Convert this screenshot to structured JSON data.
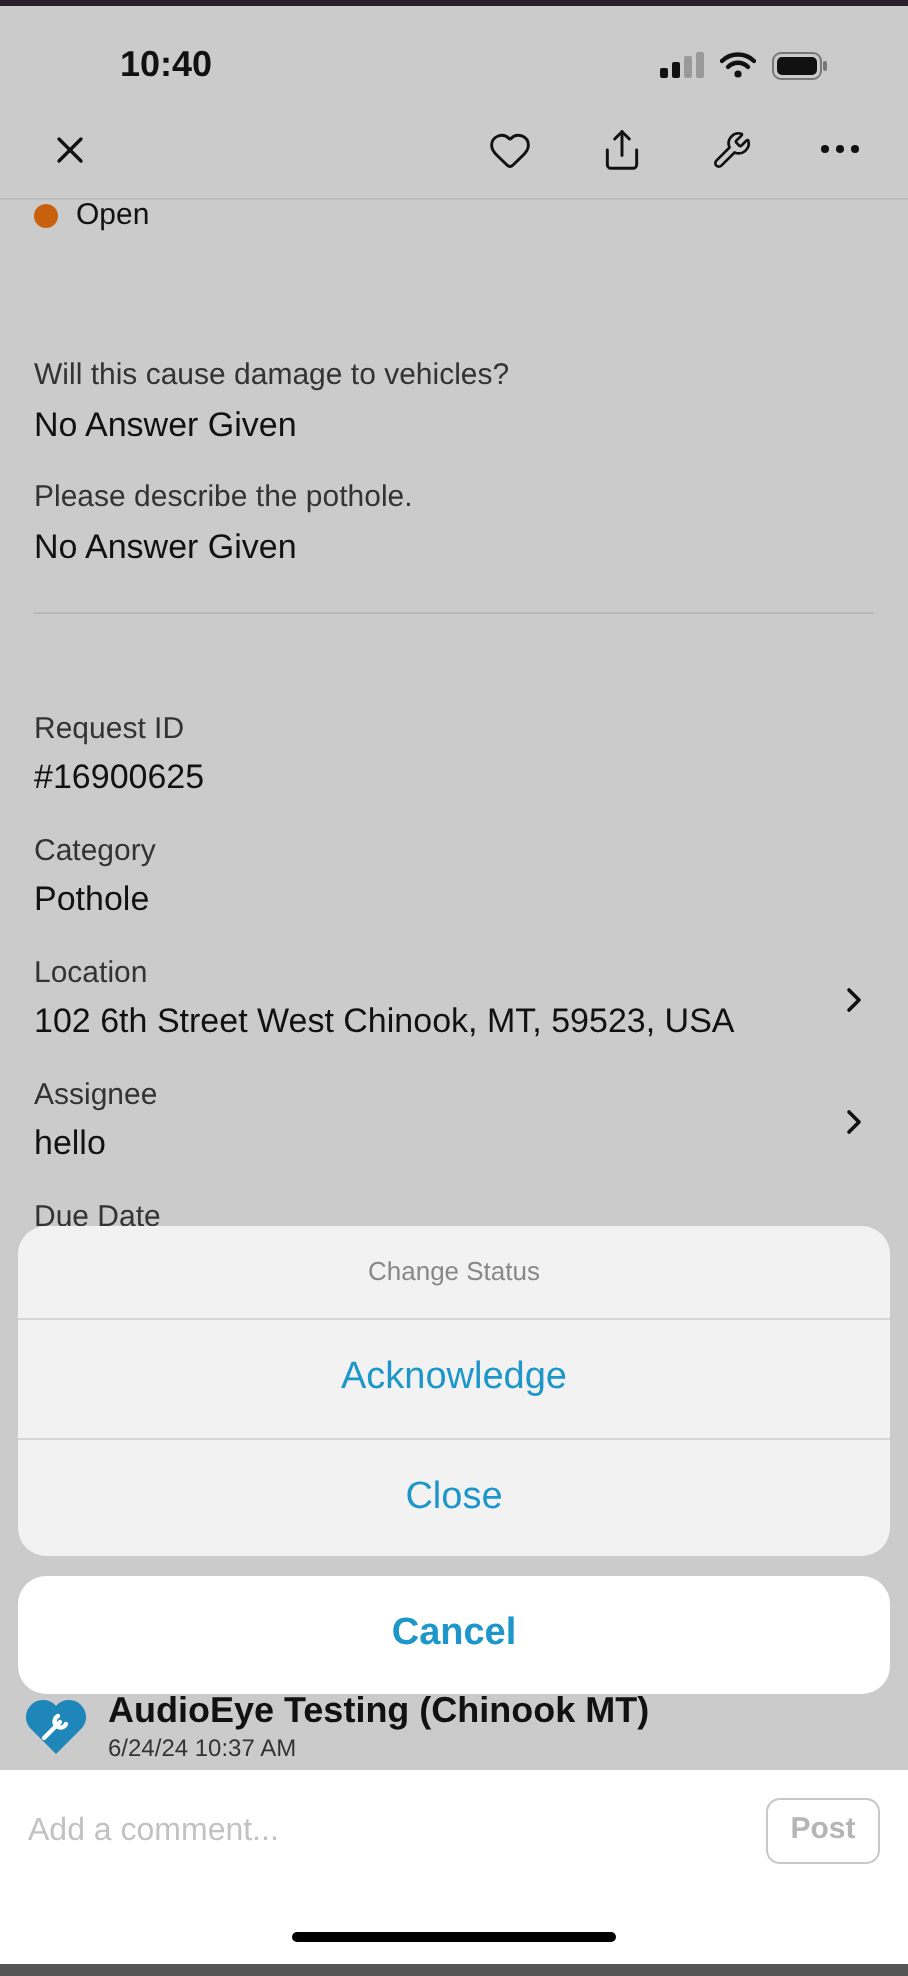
{
  "status_bar": {
    "time": "10:40"
  },
  "status": {
    "label": "Open",
    "color": "#c8600e"
  },
  "questions": [
    {
      "label": "Will this cause damage to vehicles?",
      "answer": "No Answer Given"
    },
    {
      "label": "Please describe the pothole.",
      "answer": "No Answer Given"
    }
  ],
  "fields": [
    {
      "label": "Request ID",
      "value": "#16900625",
      "has_link": false
    },
    {
      "label": "Category",
      "value": "Pothole",
      "has_link": false
    },
    {
      "label": "Location",
      "value": "102 6th Street West Chinook, MT, 59523, USA",
      "has_link": true
    },
    {
      "label": "Assignee",
      "value": "hello",
      "has_link": true
    }
  ],
  "partial_field_label": "Due Date",
  "action_sheet": {
    "title": "Change Status",
    "actions": [
      "Acknowledge",
      "Close"
    ],
    "cancel": "Cancel"
  },
  "comment": {
    "author": "AudioEye Testing (Chinook MT)",
    "time": "6/24/24 10:37 AM"
  },
  "composer": {
    "placeholder": "Add a comment...",
    "post": "Post",
    "post_disabled": true
  }
}
